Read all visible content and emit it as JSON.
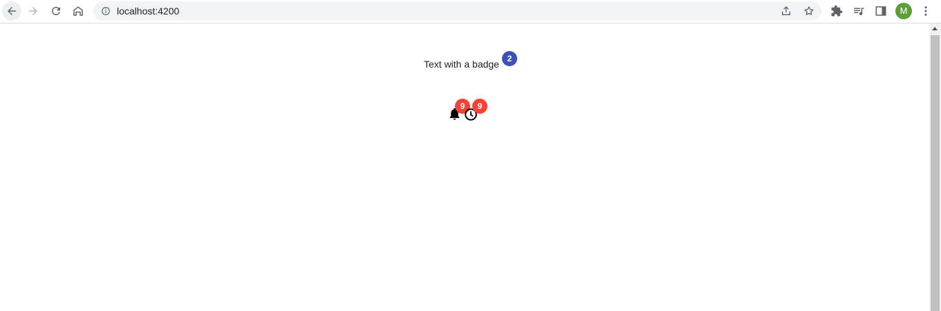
{
  "browser": {
    "url": "localhost:4200",
    "profile_initial": "M",
    "profile_color": "#5f9d3a"
  },
  "page": {
    "badge_text": "Text with a badge",
    "badge_value": "2",
    "badge_color": "#3f51b5",
    "icon_badges": [
      {
        "icon": "notifications-icon",
        "value": "9",
        "color": "#f44336"
      },
      {
        "icon": "schedule-icon",
        "value": "9",
        "color": "#f44336"
      }
    ]
  }
}
